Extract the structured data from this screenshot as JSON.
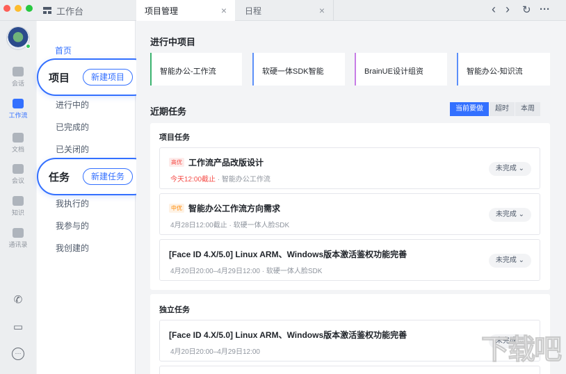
{
  "window": {
    "workspace_tab": "工作台",
    "tabs": [
      {
        "label": "项目管理",
        "close": "×"
      },
      {
        "label": "日程",
        "close": "×"
      }
    ],
    "nav": {
      "back": "‹",
      "forward": "›",
      "refresh": "↻",
      "more": "···"
    }
  },
  "rail": {
    "items": [
      {
        "label": "会话",
        "icon": "chat-icon"
      },
      {
        "label": "工作流",
        "icon": "workflow-icon"
      },
      {
        "label": "文档",
        "icon": "document-icon"
      },
      {
        "label": "会议",
        "icon": "video-icon"
      },
      {
        "label": "知识",
        "icon": "knowledge-icon"
      },
      {
        "label": "通讯录",
        "icon": "contacts-icon"
      }
    ],
    "bottom_icons": [
      "phone-icon",
      "bookmark-icon",
      "more-icon"
    ]
  },
  "sidebar": {
    "home": "首页",
    "project_group": {
      "label": "项目",
      "button": "新建项目"
    },
    "project_items": [
      "进行中的",
      "已完成的",
      "已关闭的"
    ],
    "task_group": {
      "label": "任务",
      "button": "新建任务"
    },
    "task_items": [
      "我执行的",
      "我参与的",
      "我创建的"
    ]
  },
  "main": {
    "ongoing_title": "进行中项目",
    "projects": [
      {
        "name": "智能办公-工作流",
        "color": "#3bb36f"
      },
      {
        "name": "软硬一体SDK智能",
        "color": "#5b8ff9"
      },
      {
        "name": "BrainUE设计组资",
        "color": "#c77ce6"
      },
      {
        "name": "智能办公-知识流",
        "color": "#5b8ff9"
      }
    ],
    "recent_title": "近期任务",
    "filters": [
      "当前要做",
      "超时",
      "本周"
    ],
    "project_tasks": {
      "title": "项目任务",
      "items": [
        {
          "tag": "高优",
          "name": "工作流产品改版设计",
          "due": "今天12:00截止",
          "sub": " · 智能办公工作流",
          "status": "未完成"
        },
        {
          "tag": "中优",
          "name": "智能办公工作流方向需求",
          "due": "",
          "sub": "4月28日12:00截止 · 软硬一体人脸SDK",
          "status": "未完成"
        },
        {
          "tag": "",
          "name": "[Face ID 4.X/5.0] Linux ARM、Windows版本激活鉴权功能完善",
          "due": "",
          "sub": "4月20日20:00–4月29日12:00 · 软硬一体人脸SDK",
          "status": "未完成"
        }
      ]
    },
    "independent_tasks": {
      "title": "独立任务",
      "items": [
        {
          "name": "[Face ID 4.X/5.0] Linux ARM、Windows版本激活鉴权功能完善",
          "sub": "4月20日20:00–4月29日12:00",
          "status": "未完成"
        }
      ]
    }
  },
  "watermark": "下载吧"
}
